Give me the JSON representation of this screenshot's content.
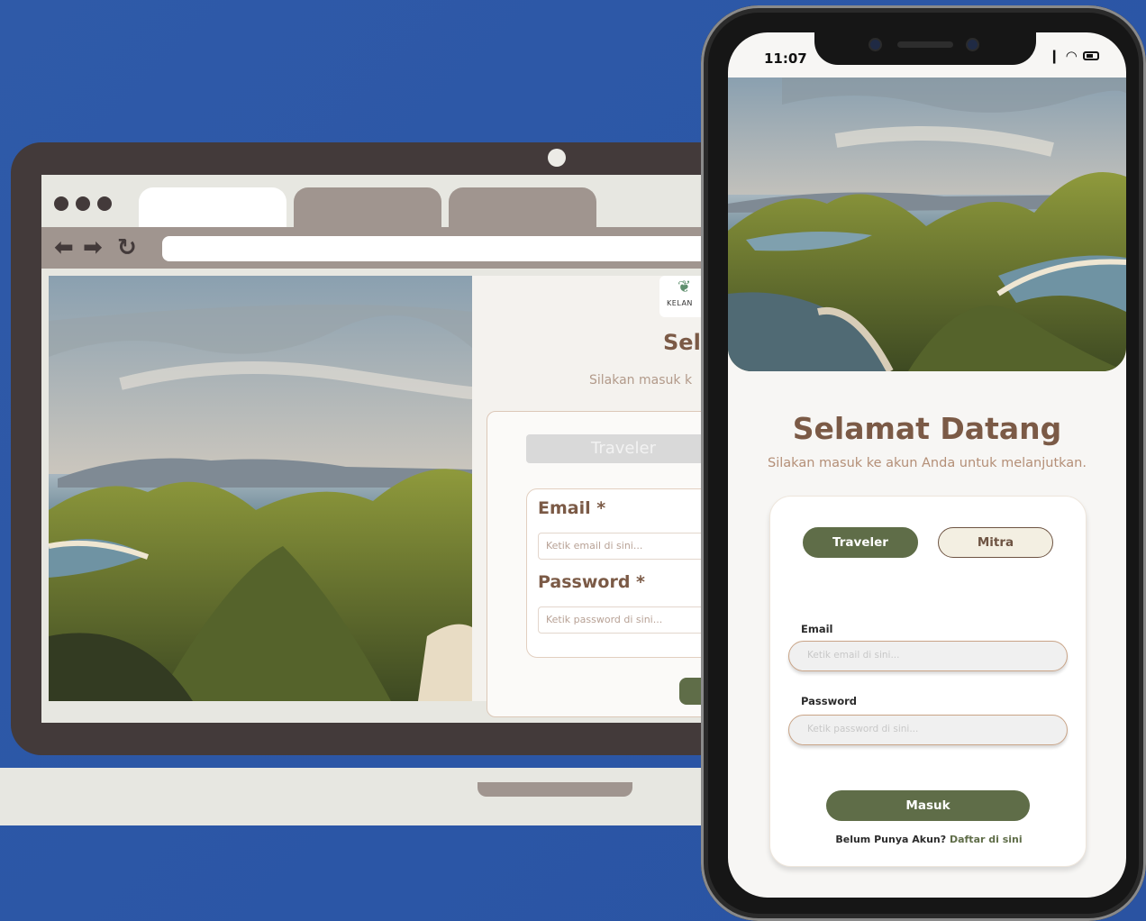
{
  "colors": {
    "background": "#2c57a6",
    "laptop_frame": "#433a3a",
    "accent_green": "#5f6d48",
    "heading_brown": "#7b5a46",
    "tab_gray": "#a0958f"
  },
  "browser": {
    "nav_icons": [
      "arrow-left-icon",
      "arrow-right-icon",
      "reload-icon"
    ]
  },
  "website": {
    "brand": "KELAN",
    "title": "Sel",
    "subtitle": "Silakan masuk k",
    "role_toggle": "Traveler",
    "email_label": "Email *",
    "email_placeholder": "Ketik email di sini...",
    "password_label": "Password *",
    "password_placeholder": "Ketik password di sini..."
  },
  "phone": {
    "status": {
      "time": "11:07"
    },
    "title": "Selamat Datang",
    "subtitle": "Silakan masuk ke akun Anda untuk melanjutkan.",
    "roles": {
      "traveler": "Traveler",
      "mitra": "Mitra"
    },
    "email_label": "Email",
    "email_placeholder": "Ketik email di sini...",
    "password_label": "Password",
    "password_placeholder": "Ketik password di sini...",
    "submit": "Masuk",
    "register_prompt": "Belum Punya Akun?",
    "register_link": "Daftar di sini"
  }
}
